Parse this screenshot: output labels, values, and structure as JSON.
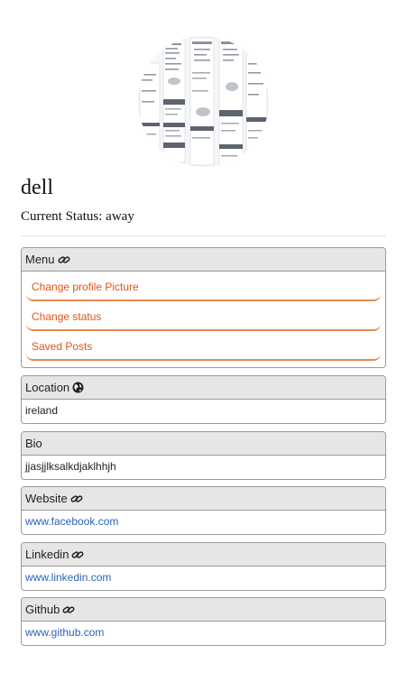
{
  "profile": {
    "username": "dell",
    "status_label": "Current Status:",
    "status_value": "away"
  },
  "menu": {
    "title": "Menu",
    "items": [
      "Change profile Picture",
      "Change status",
      "Saved Posts"
    ]
  },
  "location": {
    "title": "Location",
    "value": "ireland"
  },
  "bio": {
    "title": "Bio",
    "value": "jjasjjlksalkdjaklhhjh"
  },
  "website": {
    "title": "Website",
    "value": "www.facebook.com"
  },
  "linkedin": {
    "title": "Linkedin",
    "value": "www.linkedin.com"
  },
  "github": {
    "title": "Github",
    "value": "www.github.com"
  },
  "colors": {
    "link": "#2a63b8",
    "menu_text": "#e0531b",
    "menu_underline": "#e58a4e",
    "header_bg": "#e6e6e6"
  },
  "icons": {
    "menu": "link-icon",
    "location": "globe-icon",
    "website": "link-icon",
    "linkedin": "link-icon",
    "github": "link-icon"
  }
}
